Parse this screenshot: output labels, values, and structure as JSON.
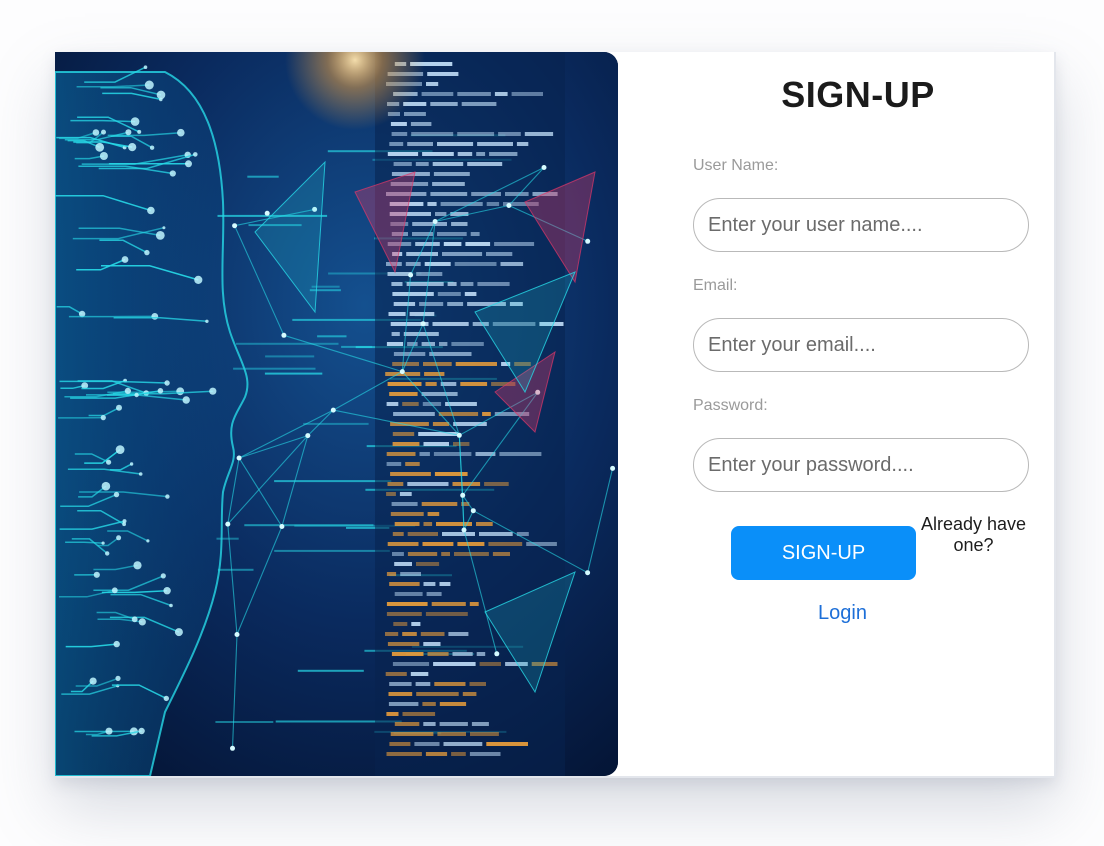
{
  "hero": {
    "image": "ai-face-with-code-illustration",
    "colors": {
      "deep": "#061a3d",
      "cyan": "#27d8e6",
      "amber": "#f2a23a",
      "magenta": "#e0386a"
    }
  },
  "form": {
    "title": "SIGN-UP",
    "fields": [
      {
        "label": "User Name:",
        "placeholder": "Enter your user name....",
        "value": ""
      },
      {
        "label": "Email:",
        "placeholder": "Enter your email....",
        "value": ""
      },
      {
        "label": "Password:",
        "placeholder": "Enter your password....",
        "value": ""
      }
    ],
    "submit_label": "SIGN-UP",
    "already_text": "Already have one?",
    "login_label": "Login",
    "colors": {
      "button": "#0a8ff9",
      "link": "#1d6fd8",
      "label": "#9a9a9a"
    }
  }
}
